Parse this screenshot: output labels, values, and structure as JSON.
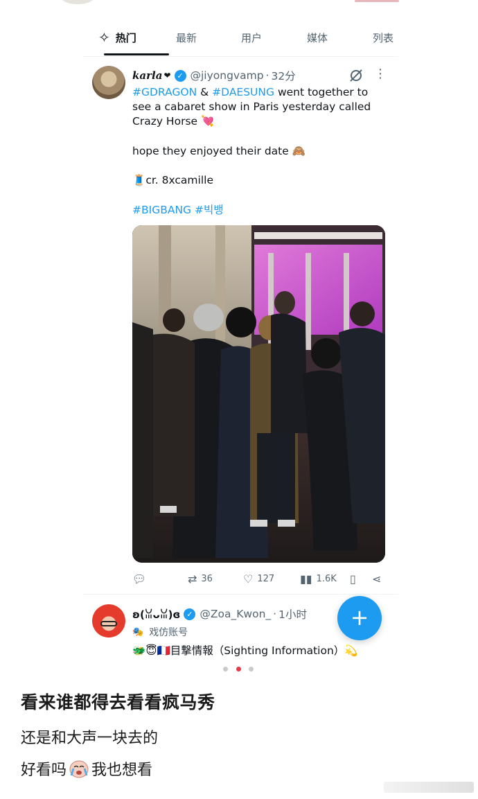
{
  "tabs": [
    {
      "label": "热门",
      "active": true
    },
    {
      "label": "最新",
      "active": false
    },
    {
      "label": "用户",
      "active": false
    },
    {
      "label": "媒体",
      "active": false
    },
    {
      "label": "列表",
      "active": false
    }
  ],
  "tweet1": {
    "display_name": "karla",
    "handle": "@jiyongvamp",
    "time": "32分",
    "line1_tag1": "#GDRAGON",
    "line1_amp": " & ",
    "line1_tag2": "#DAESUNG",
    "line1_rest": " went together to see a cabaret show in Paris yesterday called Crazy Horse",
    "line2": "hope they enjoyed their date",
    "line3": "cr. 8xcamille",
    "line4_tag1": "#BIGBANG",
    "line4_tag2": "#빅뱅",
    "stats": {
      "retweets": "36",
      "likes": "127",
      "views": "1.6K"
    }
  },
  "tweet2": {
    "display_name": "ʚ(ꈍᴗꈍ)ɞ",
    "handle": "@Zoa_Kwon_",
    "time": "1小时",
    "label": "戏仿账号",
    "body": "🐲😇🇫🇷目撃情報（Sighting Information）💫"
  },
  "fab_label": "+",
  "pagination": {
    "total": 3,
    "active_index": 1
  },
  "post": {
    "title": "看来谁都得去看看疯马秀",
    "line1": "还是和大声一块去的",
    "line2_before": "好看吗",
    "line2_after": "我也想看"
  },
  "colors": {
    "accent": "#1d9bf0",
    "muted": "#536471",
    "pagination_active": "#e8394b"
  }
}
